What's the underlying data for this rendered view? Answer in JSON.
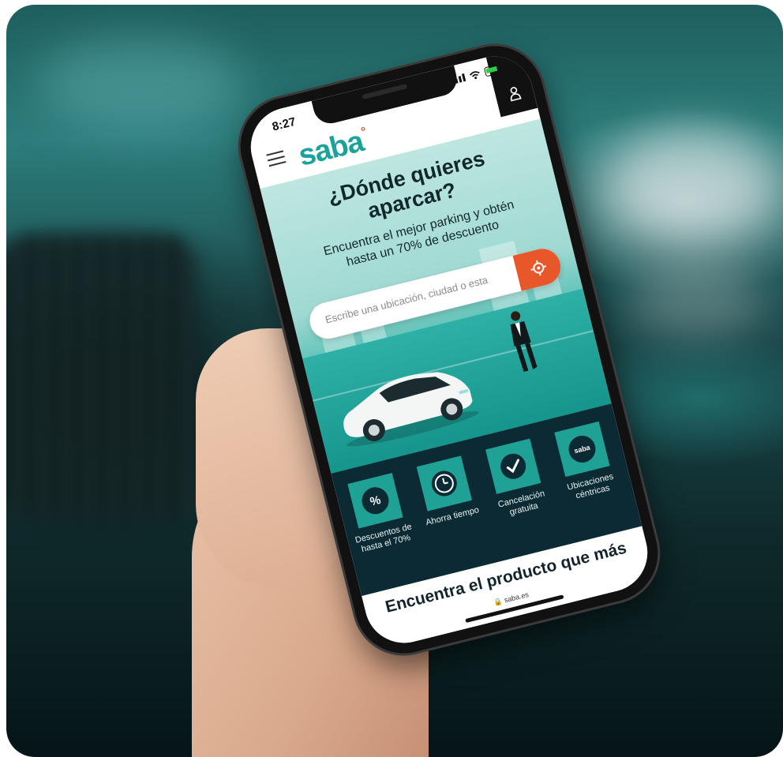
{
  "status": {
    "time": "8:27"
  },
  "header": {
    "logo": "saba",
    "logo_mark": "°"
  },
  "hero": {
    "title": "¿Dónde quieres aparcar?",
    "subtitle": "Encuentra el mejor parking y obtén hasta un 70% de descuento"
  },
  "search": {
    "placeholder": "Escribe una ubicación, ciudad o esta"
  },
  "features": [
    {
      "label": "Descuentos de hasta el 70%",
      "icon": "percent-icon"
    },
    {
      "label": "Ahorra tiempo",
      "icon": "clock-icon"
    },
    {
      "label": "Cancelación gratuita",
      "icon": "check-icon"
    },
    {
      "label": "Ubicaciones céntricas",
      "icon": "saba-logo-icon",
      "icon_text": "saba"
    }
  ],
  "section": {
    "title": "Encuentra el producto que más"
  },
  "browser": {
    "url": "saba.es"
  },
  "colors": {
    "brand_teal": "#1aa39a",
    "accent_orange": "#e8572a",
    "dark_navy": "#0c2a34"
  }
}
